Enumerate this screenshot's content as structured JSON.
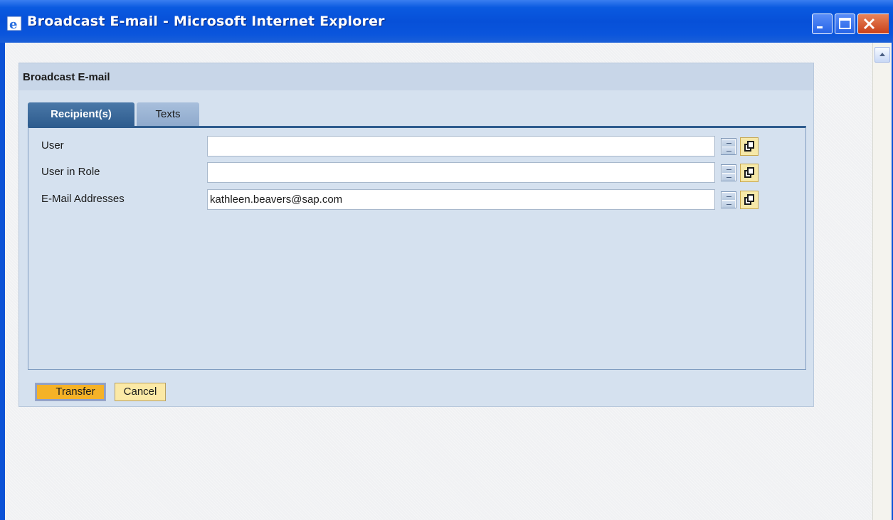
{
  "window": {
    "title": "Broadcast E-mail - Microsoft Internet Explorer"
  },
  "dialog": {
    "title": "Broadcast E-mail",
    "tabs": [
      {
        "label": "Recipient(s)",
        "active": true
      },
      {
        "label": "Texts",
        "active": false
      }
    ],
    "fields": [
      {
        "label": "User",
        "value": ""
      },
      {
        "label": "User in Role",
        "value": ""
      },
      {
        "label": "E-Mail Addresses",
        "value": "kathleen.beavers@sap.com"
      }
    ],
    "buttons": {
      "transfer": "Transfer",
      "cancel": "Cancel"
    }
  },
  "colors": {
    "titlebar": "#0a5ae0",
    "panel": "#d5e1ef",
    "active_tab": "#2e5c8e",
    "primary_button": "#f5b227"
  }
}
